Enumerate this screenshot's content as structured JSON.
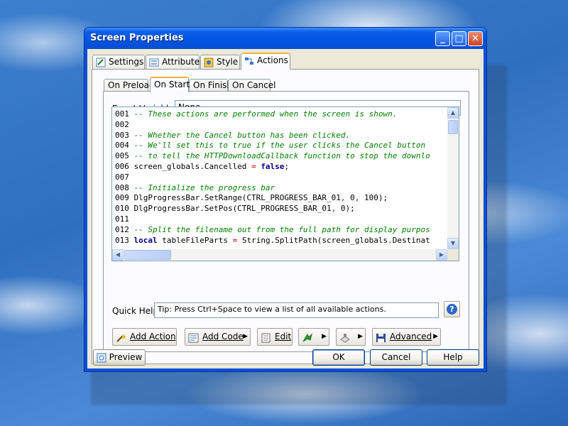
{
  "window": {
    "title": "Screen Properties",
    "minimize_glyph": "_",
    "maximize_glyph": "□",
    "close_glyph": "✕"
  },
  "tabs": [
    {
      "label": "Settings",
      "icon": "settings-icon"
    },
    {
      "label": "Attributes",
      "icon": "attributes-icon"
    },
    {
      "label": "Style",
      "icon": "style-icon"
    },
    {
      "label": "Actions",
      "icon": "actions-icon",
      "active": true
    }
  ],
  "subtabs": [
    {
      "label": "On Preload"
    },
    {
      "label": "On Start",
      "active": true
    },
    {
      "label": "On Finish"
    },
    {
      "label": "On Cancel"
    }
  ],
  "event_variables": {
    "label": "Event Variables:",
    "value": "None"
  },
  "code_lines": [
    [
      [
        "n",
        "001 "
      ],
      [
        "c",
        "-- These actions are performed when the screen is shown."
      ]
    ],
    [
      [
        "n",
        "002"
      ]
    ],
    [
      [
        "n",
        "003 "
      ],
      [
        "c",
        "-- Whether the Cancel button has been clicked."
      ]
    ],
    [
      [
        "n",
        "004 "
      ],
      [
        "c",
        "-- We'll set this to true if the user clicks the Cancel button"
      ]
    ],
    [
      [
        "n",
        "005 "
      ],
      [
        "c",
        "-- to tell the HTTPDownloadCallback function to stop the downlo"
      ]
    ],
    [
      [
        "n",
        "006 screen_globals.Cancelled "
      ],
      [
        "r",
        "="
      ],
      [
        "n",
        " "
      ],
      [
        "k",
        "false"
      ],
      [
        "n",
        ";"
      ]
    ],
    [
      [
        "n",
        "007"
      ]
    ],
    [
      [
        "n",
        "008 "
      ],
      [
        "c",
        "-- Initialize the progress bar"
      ]
    ],
    [
      [
        "n",
        "009 DlgProgressBar.SetRange(CTRL_PROGRESS_BAR_01"
      ],
      [
        "r",
        ","
      ],
      [
        "n",
        " 0"
      ],
      [
        "r",
        ","
      ],
      [
        "n",
        " 100);"
      ]
    ],
    [
      [
        "n",
        "010 DlgProgressBar.SetPos(CTRL_PROGRESS_BAR_01"
      ],
      [
        "r",
        ","
      ],
      [
        "n",
        " 0);"
      ]
    ],
    [
      [
        "n",
        "011"
      ]
    ],
    [
      [
        "n",
        "012 "
      ],
      [
        "c",
        "-- Split the filename out from the full path for display purpos"
      ]
    ],
    [
      [
        "n",
        "013 "
      ],
      [
        "k",
        "local"
      ],
      [
        "n",
        " tableFileParts "
      ],
      [
        "r",
        "="
      ],
      [
        "n",
        " String.SplitPath(screen_globals.Destinat"
      ]
    ]
  ],
  "quick_help": {
    "label": "Quick Help:",
    "value": "Tip: Press Ctrl+Space to view a list of all available actions."
  },
  "toolbar": {
    "add_action": "Add Action",
    "add_code": "Add Code",
    "edit": "Edit",
    "advanced": "Advanced"
  },
  "footer": {
    "preview": "Preview",
    "ok": "OK",
    "cancel": "Cancel",
    "help": "Help"
  },
  "colors": {
    "comment": "#008000",
    "keyword": "#00008b",
    "operator": "#c00000",
    "active_tab_accent": "#f9b33d"
  }
}
